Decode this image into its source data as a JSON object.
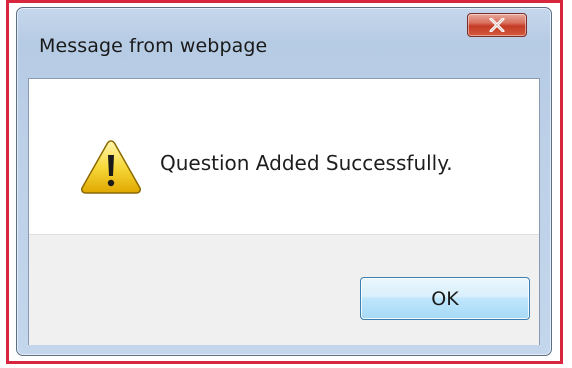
{
  "dialog": {
    "title": "Message from webpage",
    "message": "Question Added Successfully.",
    "ok_label": "OK",
    "icon": "warning-icon",
    "close_icon": "close-icon"
  },
  "colors": {
    "highlight_border": "#d7263d",
    "title_bar": "#bcd0e8",
    "close_button": "#c43c26",
    "ok_button": "#bee6fd",
    "footer": "#f0f0f0"
  }
}
